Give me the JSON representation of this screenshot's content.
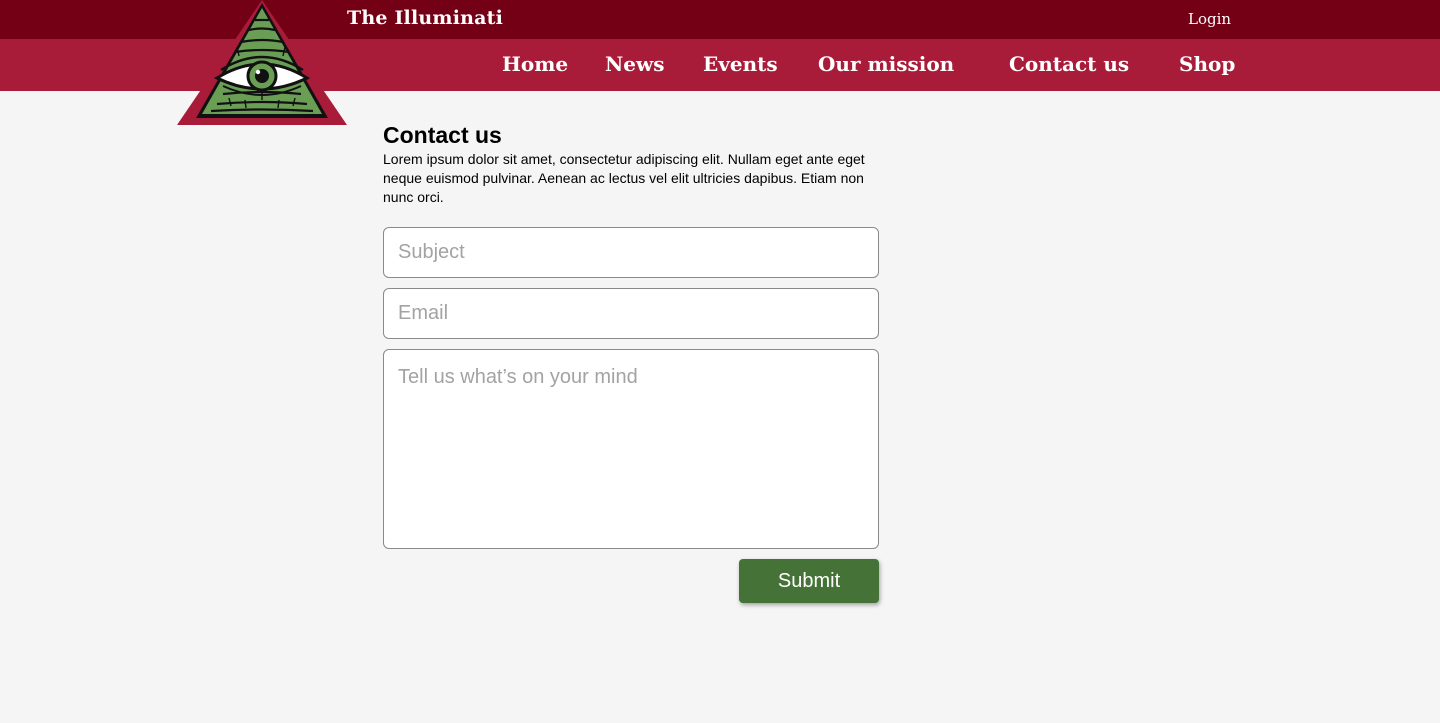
{
  "header": {
    "site_title": "The Illuminati",
    "login_label": "Login"
  },
  "nav": {
    "items": [
      {
        "label": "Home"
      },
      {
        "label": "News"
      },
      {
        "label": "Events"
      },
      {
        "label": "Our mission"
      },
      {
        "label": "Contact us"
      },
      {
        "label": "Shop"
      }
    ]
  },
  "logo": {
    "icon": "eye-of-providence-icon"
  },
  "contact": {
    "title": "Contact us",
    "intro": "Lorem ipsum dolor sit amet, consectetur adipiscing elit. Nullam eget ante eget neque euismod pulvinar. Aenean ac lectus vel elit ultricies dapibus. Etiam non nunc orci.",
    "subject_placeholder": "Subject",
    "email_placeholder": "Email",
    "message_placeholder": "Tell us what’s on your mind",
    "submit_label": "Submit"
  },
  "colors": {
    "topbar": "#740015",
    "navbar": "#a81c3a",
    "page_background": "#f5f5f5",
    "submit_button": "#457236",
    "logo_green": "#6a9e55"
  }
}
